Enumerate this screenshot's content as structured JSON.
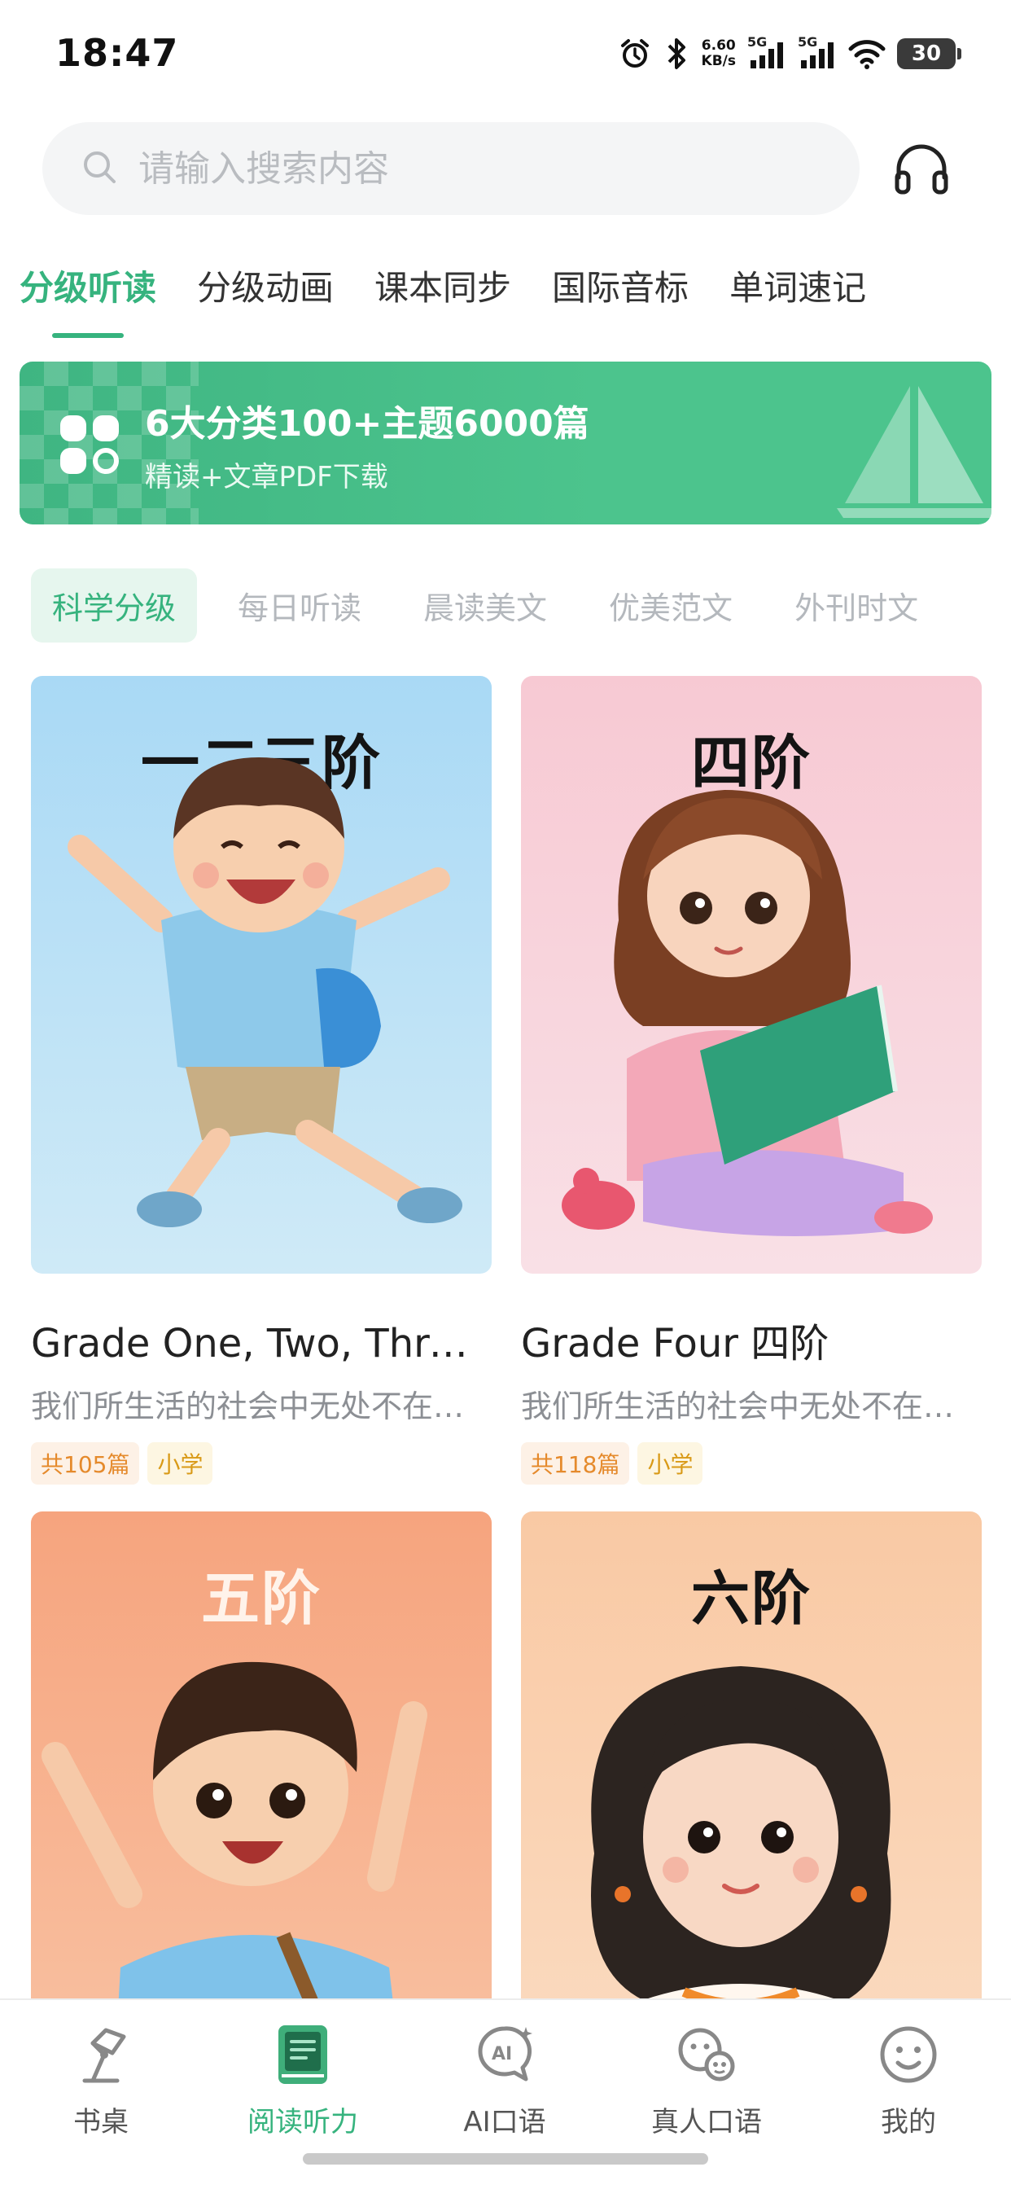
{
  "status": {
    "time": "18:47",
    "net_speed_value": "6.60",
    "net_speed_unit": "KB/s",
    "sim1": "5G",
    "sim2": "5G",
    "battery": "30"
  },
  "search": {
    "placeholder": "请输入搜索内容"
  },
  "top_tabs": [
    {
      "label": "分级听读",
      "active": true
    },
    {
      "label": "分级动画",
      "active": false
    },
    {
      "label": "课本同步",
      "active": false
    },
    {
      "label": "国际音标",
      "active": false
    },
    {
      "label": "单词速记",
      "active": false
    }
  ],
  "banner": {
    "title": "6大分类100+主题6000篇",
    "subtitle": "精读+文章PDF下载"
  },
  "sub_tabs": [
    {
      "label": "科学分级",
      "active": true
    },
    {
      "label": "每日听读",
      "active": false
    },
    {
      "label": "晨读美文",
      "active": false
    },
    {
      "label": "优美范文",
      "active": false
    },
    {
      "label": "外刊时文",
      "active": false
    }
  ],
  "cards": [
    {
      "grade": "一二三阶",
      "title": "Grade One, Two, Three 一二三阶",
      "desc": "我们所生活的社会中无处不在的英语",
      "count": "共105篇",
      "level": "小学"
    },
    {
      "grade": "四阶",
      "title": "Grade Four 四阶",
      "desc": "我们所生活的社会中无处不在的英语",
      "count": "共118篇",
      "level": "小学"
    },
    {
      "grade": "五阶"
    },
    {
      "grade": "六阶"
    }
  ],
  "nav": [
    {
      "label": "书桌",
      "icon": "desk-lamp-icon",
      "active": false
    },
    {
      "label": "阅读听力",
      "icon": "book-icon",
      "active": true
    },
    {
      "label": "AI口语",
      "icon": "ai-chat-icon",
      "active": false
    },
    {
      "label": "真人口语",
      "icon": "people-chat-icon",
      "active": false
    },
    {
      "label": "我的",
      "icon": "smiley-icon",
      "active": false
    }
  ],
  "colors": {
    "accent": "#36b37e",
    "banner": "#4cc48d",
    "tag_count": "#e58a2c",
    "tag_level": "#d99a17"
  }
}
